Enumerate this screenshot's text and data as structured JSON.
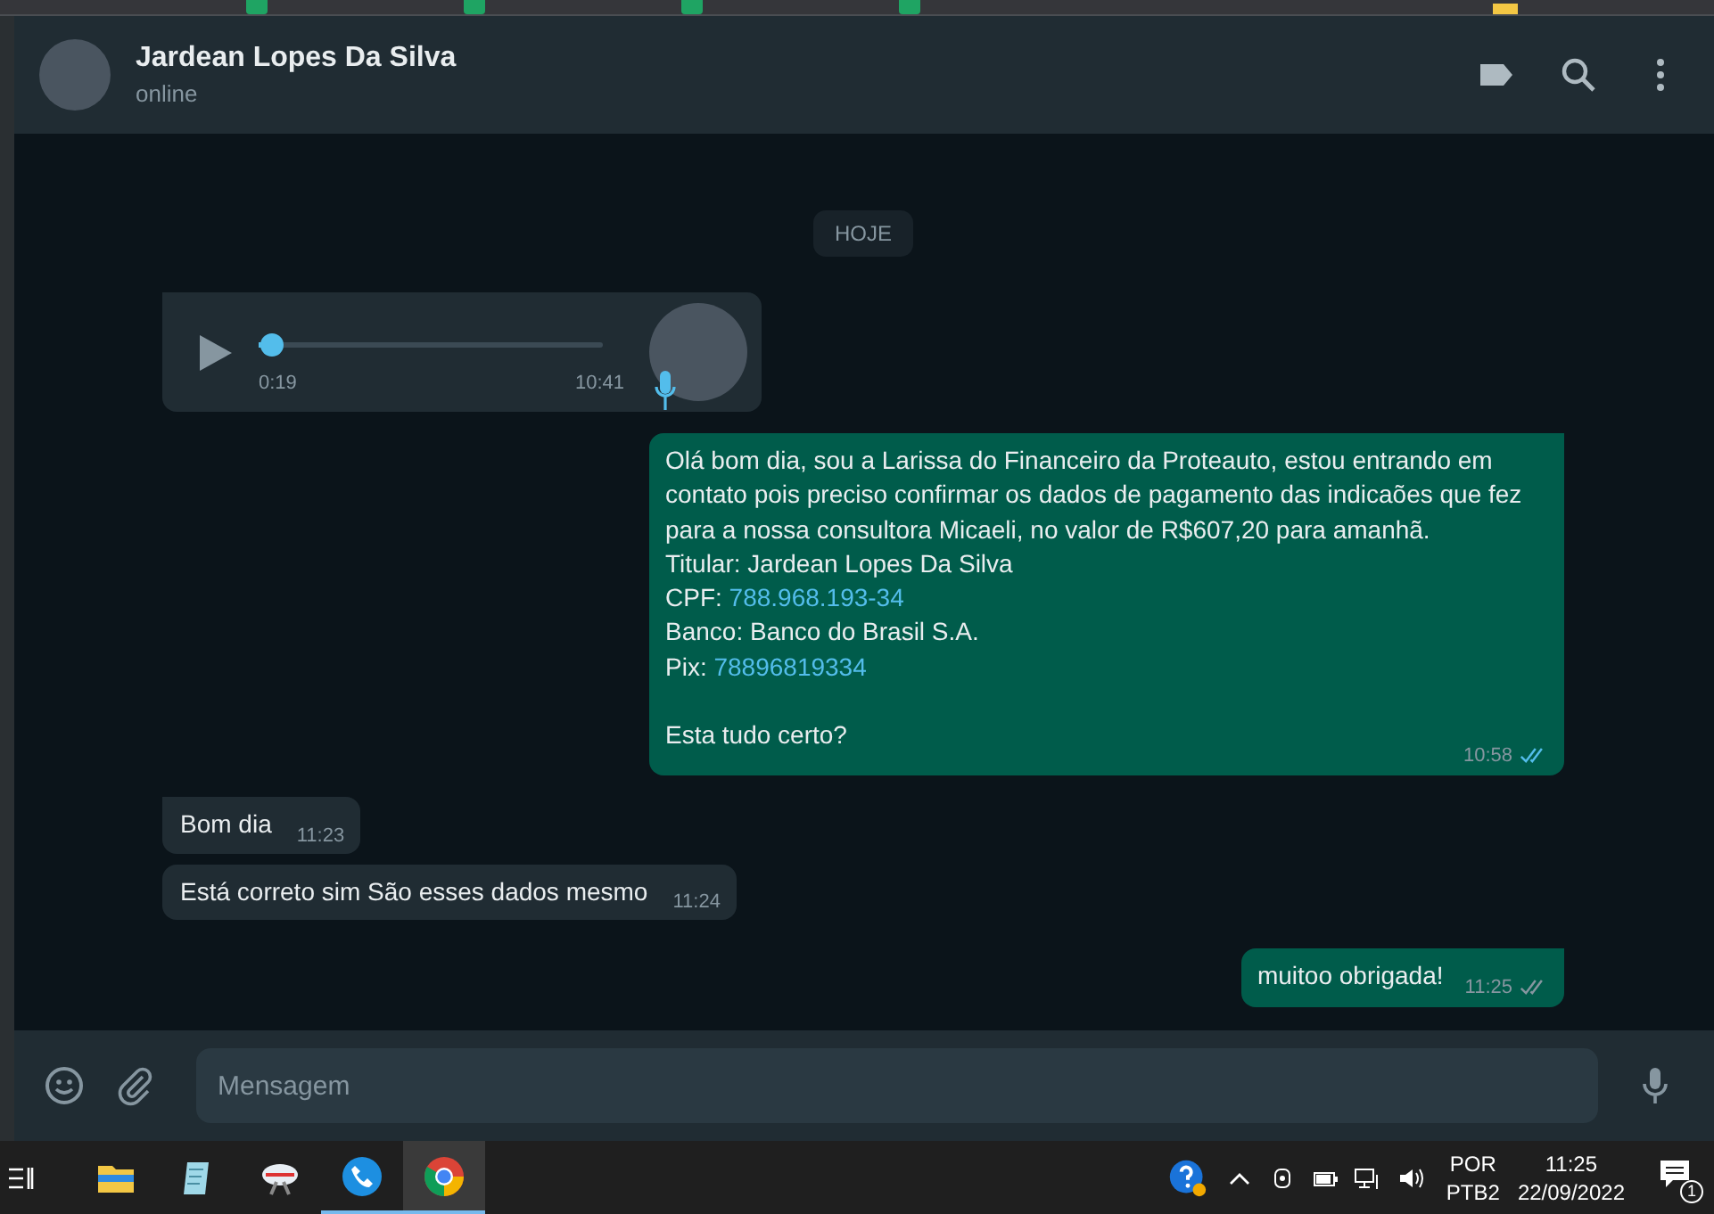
{
  "contact": {
    "name": "Jardean Lopes Da Silva",
    "status": "online"
  },
  "date_chip": "HOJE",
  "messages": [
    {
      "kind": "audio",
      "outgoing": false,
      "level": 0.02,
      "duration": "0:19",
      "time": "10:41"
    },
    {
      "kind": "text",
      "outgoing": true,
      "read": true,
      "paragraph": "Olá bom dia, sou a Larissa do Financeiro da Proteauto, estou entrando em contato pois preciso confirmar os dados de pagamento das indicaões que fez para a nossa consultora Micaeli, no valor de R$607,20 para amanhã.",
      "fields": [
        {
          "label": "Titular:",
          "value": "Jardean Lopes Da Silva",
          "link": false
        },
        {
          "label": "CPF:",
          "value": "788.968.193-34",
          "link": true
        },
        {
          "label": "Banco:",
          "value": "Banco do Brasil S.A.",
          "link": false
        },
        {
          "label": "Pix:",
          "value": "78896819334",
          "link": true
        }
      ],
      "closing": "Esta tudo certo?",
      "time": "10:58"
    },
    {
      "kind": "text",
      "outgoing": false,
      "tail": true,
      "paragraph": "Bom dia",
      "time": "11:23"
    },
    {
      "kind": "text",
      "outgoing": false,
      "tail": false,
      "paragraph": "Está correto sim São esses dados mesmo",
      "time": "11:24"
    },
    {
      "kind": "text",
      "outgoing": true,
      "read": false,
      "paragraph": "muitoo obrigada!",
      "time": "11:25"
    }
  ],
  "composer": {
    "placeholder": "Mensagem"
  },
  "taskbar": {
    "language": "POR",
    "layout": "PTB2",
    "time": "11:25",
    "date": "22/09/2022",
    "notifications": "1"
  }
}
